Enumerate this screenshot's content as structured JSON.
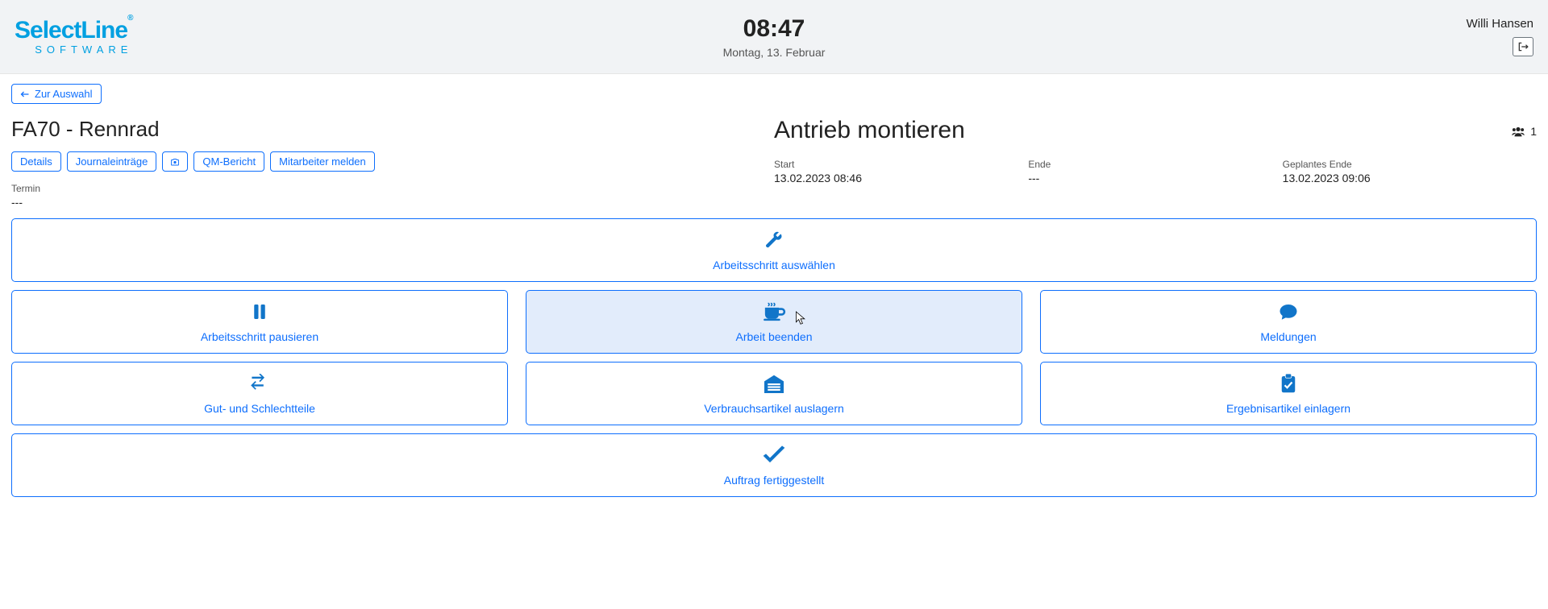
{
  "header": {
    "logo_line1": "SelectLine",
    "logo_line2": "SOFTWARE",
    "time": "08:47",
    "date": "Montag, 13. Februar",
    "user": "Willi Hansen"
  },
  "nav": {
    "back_label": "Zur Auswahl"
  },
  "order": {
    "title": "FA70 - Rennrad",
    "tabs": {
      "details": "Details",
      "journal": "Journaleinträge",
      "qm": "QM-Bericht",
      "report_employee": "Mitarbeiter melden"
    },
    "termin_label": "Termin",
    "termin_value": "---"
  },
  "task": {
    "title": "Antrieb montieren",
    "people_count": "1",
    "start_label": "Start",
    "start_value": "13.02.2023 08:46",
    "end_label": "Ende",
    "end_value": "---",
    "planned_end_label": "Geplantes Ende",
    "planned_end_value": "13.02.2023 09:06"
  },
  "tiles": {
    "select_step": "Arbeitsschritt auswählen",
    "pause_step": "Arbeitsschritt pausieren",
    "end_work": "Arbeit beenden",
    "messages": "Meldungen",
    "good_bad": "Gut- und Schlechtteile",
    "withdraw": "Verbrauchsartikel auslagern",
    "store_result": "Ergebnisartikel einlagern",
    "complete_order": "Auftrag fertiggestellt"
  }
}
